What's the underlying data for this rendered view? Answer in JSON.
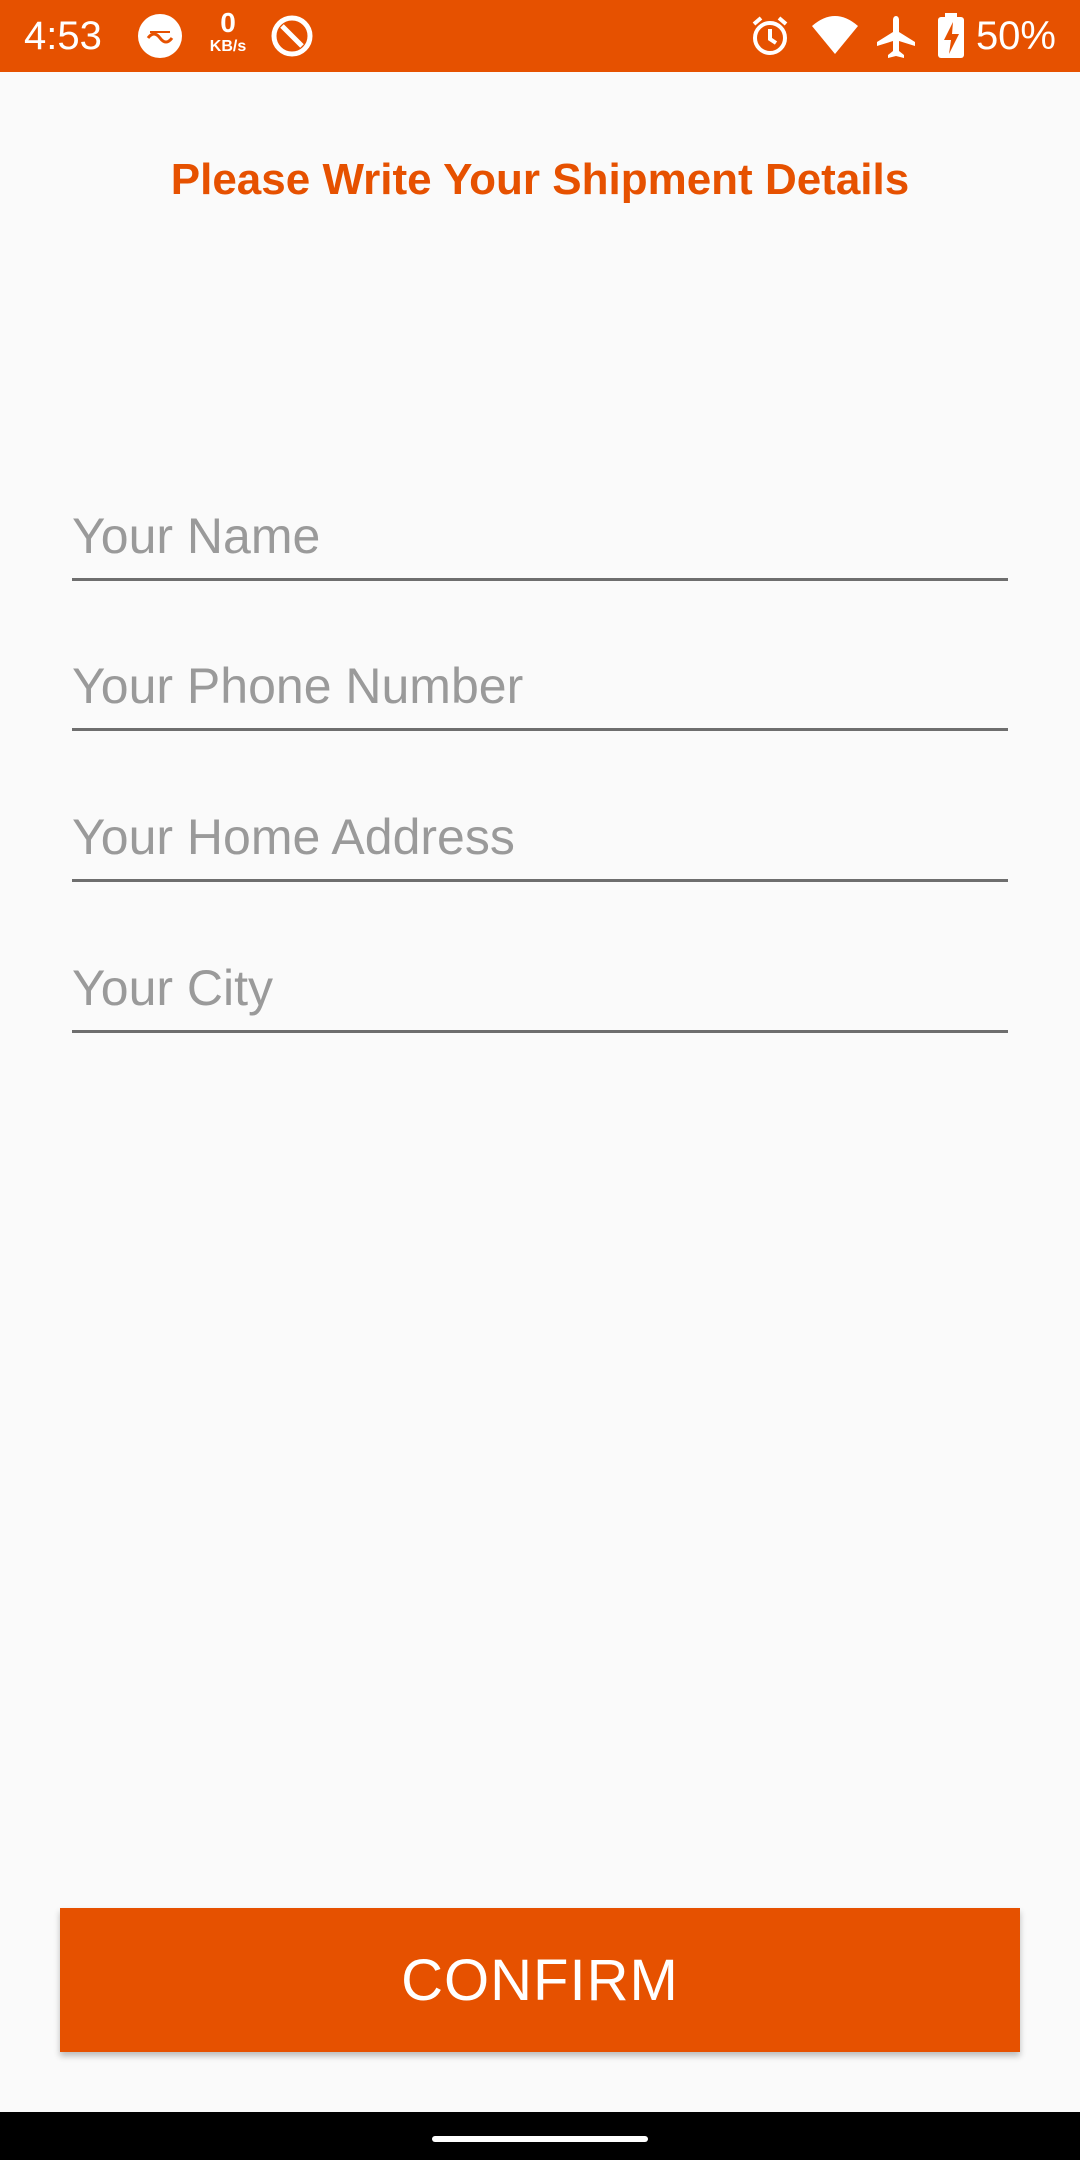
{
  "status_bar": {
    "time": "4:53",
    "net_speed_value": "0",
    "net_speed_unit": "KB/s",
    "battery_percent": "50%",
    "background_color": "#e65100",
    "icons": [
      "app-badge-icon",
      "vpn-key-icon",
      "alarm-icon",
      "wifi-icon",
      "airplane-icon",
      "battery-charging-icon"
    ]
  },
  "header": {
    "title": "Please Write Your Shipment Details",
    "color": "#e65100"
  },
  "form": {
    "name_placeholder": "Your Name",
    "phone_placeholder": "Your Phone Number",
    "address_placeholder": "Your Home Address",
    "city_placeholder": "Your City",
    "name_value": "",
    "phone_value": "",
    "address_value": "",
    "city_value": ""
  },
  "actions": {
    "confirm_label": "CONFIRM",
    "accent_color": "#e65100"
  }
}
